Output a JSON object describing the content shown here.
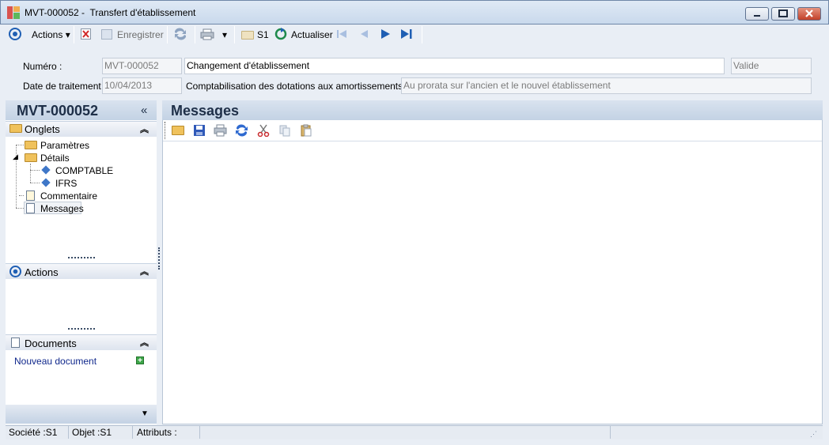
{
  "window": {
    "title": "MVT-000052 -  Transfert d'établissement",
    "controls": [
      "minimize-icon",
      "maximize-icon",
      "close-icon"
    ]
  },
  "toolbar": {
    "actions_label": "Actions",
    "save_label": "Enregistrer",
    "company_label": "S1",
    "refresh_label": "Actualiser"
  },
  "header": {
    "numero_label": "Numéro :",
    "numero_value": "MVT-000052",
    "description_value": "Changement d'établissement",
    "status_value": "Valide",
    "date_label": "Date de traitement :",
    "date_value": "10/04/2013",
    "compta_label": "Comptabilisation des dotations aux amortissements :",
    "compta_value": "Au prorata sur l'ancien et le nouvel établissement"
  },
  "left_panel": {
    "title": "MVT-000052",
    "collapse_glyph": "«",
    "onglets_title": "Onglets",
    "tree": {
      "parametres": "Paramètres",
      "details": "Détails",
      "comptable": "COMPTABLE",
      "ifrs": "IFRS",
      "commentaire": "Commentaire",
      "messages": "Messages"
    },
    "actions_title": "Actions",
    "documents_title": "Documents",
    "new_document": "Nouveau document"
  },
  "main": {
    "title": "Messages"
  },
  "status_bar": {
    "societe": "Société :S1",
    "objet": "Objet :S1",
    "attributs": "Attributs :"
  },
  "colors": {
    "accent": "#1f5fb4",
    "header_gradient": "#c3d2e4",
    "link": "#10288c"
  }
}
